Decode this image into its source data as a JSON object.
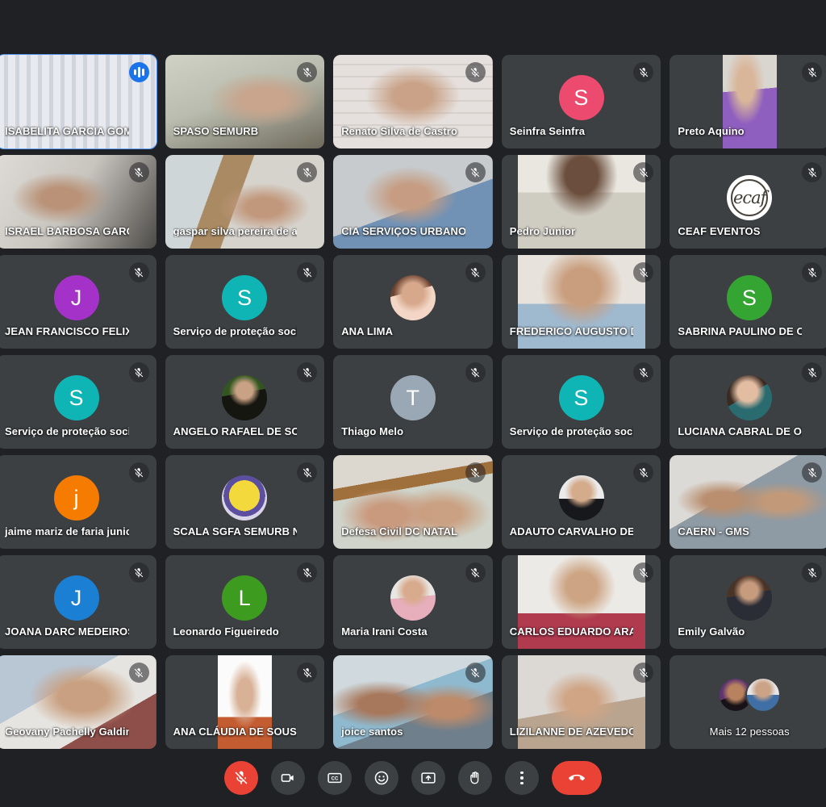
{
  "meeting": {
    "grid_columns": 5,
    "grid_rows": 7,
    "background_color": "#202124",
    "tile_color": "#3c4043",
    "active_speaker_border_color": "#5b9bf8"
  },
  "participants": [
    {
      "name": "ISABELITA GARCIA GOM...",
      "kind": "video",
      "muted": false,
      "speaking": true,
      "video_style": "vertical-blinds",
      "name_align": "left"
    },
    {
      "name": "SPASO SEMURB",
      "kind": "video",
      "muted": true,
      "speaking": false,
      "video_style": "man-frame-wall",
      "name_align": "left"
    },
    {
      "name": "Renato Silva de Castro",
      "kind": "video",
      "muted": true,
      "speaking": false,
      "video_style": "older-man-tile-wall",
      "name_align": "left"
    },
    {
      "name": "Seinfra Seinfra",
      "kind": "avatar",
      "initial": "S",
      "avatar_color": "#ec4a6e",
      "muted": true,
      "speaking": false,
      "name_align": "left"
    },
    {
      "name": "Preto Aquino",
      "kind": "video",
      "muted": true,
      "speaking": false,
      "video_style": "young-man-purple",
      "letterbox": "narrow",
      "name_align": "left"
    },
    {
      "name": "ISRAEL BARBOSA GARCIA",
      "kind": "video",
      "muted": true,
      "speaking": false,
      "video_style": "man-office-desk",
      "name_align": "left"
    },
    {
      "name": "gaspar silva pereira de a...",
      "kind": "video",
      "muted": true,
      "speaking": false,
      "video_style": "man-map-office",
      "name_align": "left"
    },
    {
      "name": "CIA SERVIÇOS URBANOS",
      "kind": "video",
      "muted": true,
      "speaking": false,
      "video_style": "man-blue-shirt-room",
      "name_align": "left"
    },
    {
      "name": "Pedro Junior",
      "kind": "video",
      "muted": true,
      "speaking": false,
      "video_style": "man-white-tshirt",
      "letterbox": "wide",
      "name_align": "left"
    },
    {
      "name": "CEAF EVENTOS",
      "kind": "logo",
      "logo_text": "ecaf",
      "muted": true,
      "speaking": false,
      "name_align": "left"
    },
    {
      "name": "JEAN FRANCISCO FELIX ...",
      "kind": "avatar",
      "initial": "J",
      "avatar_color": "#a532c8",
      "muted": true,
      "speaking": false,
      "name_align": "left"
    },
    {
      "name": "Serviço de proteção soci...",
      "kind": "avatar",
      "initial": "S",
      "avatar_color": "#0fb5b5",
      "muted": true,
      "speaking": false,
      "name_align": "left"
    },
    {
      "name": "ANA LIMA",
      "kind": "avatar-photo",
      "avatar_photo": "woman-curly-hair",
      "muted": true,
      "speaking": false,
      "name_align": "left"
    },
    {
      "name": "FREDERICO AUGUSTO D...",
      "kind": "video",
      "muted": true,
      "speaking": false,
      "video_style": "bald-man-blue-shirt",
      "letterbox": "wide",
      "name_align": "left"
    },
    {
      "name": "SABRINA PAULINO DE O...",
      "kind": "avatar",
      "initial": "S",
      "avatar_color": "#34a532",
      "muted": true,
      "speaking": false,
      "name_align": "left"
    },
    {
      "name": "Serviço de proteção soci...",
      "kind": "avatar",
      "initial": "S",
      "avatar_color": "#0fb5b5",
      "muted": true,
      "speaking": false,
      "name_align": "left"
    },
    {
      "name": "ANGELO RAFAEL DE SO...",
      "kind": "avatar-photo",
      "avatar_photo": "man-sunglasses-foliage",
      "muted": true,
      "speaking": false,
      "name_align": "left"
    },
    {
      "name": "Thiago Melo",
      "kind": "avatar",
      "initial": "T",
      "avatar_color": "#9aa8b5",
      "muted": true,
      "speaking": false,
      "name_align": "left"
    },
    {
      "name": "Serviço de proteção soci...",
      "kind": "avatar",
      "initial": "S",
      "avatar_color": "#0fb5b5",
      "muted": true,
      "speaking": false,
      "name_align": "left"
    },
    {
      "name": "LUCIANA CABRAL DE OL...",
      "kind": "avatar-photo",
      "avatar_photo": "woman-long-hair",
      "muted": true,
      "speaking": false,
      "name_align": "left"
    },
    {
      "name": "jaime mariz de faria junior",
      "kind": "avatar",
      "initial": "j",
      "avatar_color": "#f57c00",
      "muted": true,
      "speaking": false,
      "name_align": "left"
    },
    {
      "name": "SCALA SGFA SEMURB N...",
      "kind": "crest",
      "muted": true,
      "speaking": false,
      "name_align": "left"
    },
    {
      "name": "Defesa Civil DC NATAL",
      "kind": "video",
      "muted": true,
      "speaking": false,
      "video_style": "two-women-painting",
      "name_align": "left"
    },
    {
      "name": "ADAUTO CARVALHO DE ...",
      "kind": "avatar-photo",
      "avatar_photo": "man-beard-black-shirt",
      "muted": true,
      "speaking": false,
      "name_align": "left"
    },
    {
      "name": "CAERN - GMS",
      "kind": "video",
      "muted": true,
      "speaking": false,
      "video_style": "two-men-office",
      "name_align": "left"
    },
    {
      "name": "JOANA DARC MEDEIROS",
      "kind": "avatar",
      "initial": "J",
      "avatar_color": "#1b7fd4",
      "muted": true,
      "speaking": false,
      "name_align": "left"
    },
    {
      "name": "Leonardo Figueiredo",
      "kind": "avatar",
      "initial": "L",
      "avatar_color": "#3d9c20",
      "muted": true,
      "speaking": false,
      "name_align": "left"
    },
    {
      "name": "Maria Irani Costa",
      "kind": "avatar-photo",
      "avatar_photo": "woman-pink-top",
      "muted": true,
      "speaking": false,
      "name_align": "left"
    },
    {
      "name": "CARLOS EDUARDO ARA...",
      "kind": "video",
      "muted": true,
      "speaking": false,
      "video_style": "man-headphones-red",
      "letterbox": "wide",
      "name_align": "left"
    },
    {
      "name": "Emily Galvão",
      "kind": "avatar-photo",
      "avatar_photo": "woman-dark-jacket",
      "muted": true,
      "speaking": false,
      "name_align": "left"
    },
    {
      "name": "Geovany Pachelly Galdin...",
      "kind": "video",
      "muted": true,
      "speaking": false,
      "video_style": "man-glasses-door",
      "name_align": "left"
    },
    {
      "name": "ANA CLÁUDIA DE SOUS...",
      "kind": "video",
      "muted": true,
      "speaking": false,
      "video_style": "woman-white-bg",
      "letterbox": "narrow",
      "name_align": "left"
    },
    {
      "name": "joice santos",
      "kind": "video",
      "muted": true,
      "speaking": false,
      "video_style": "two-women-blue-wall",
      "name_align": "left"
    },
    {
      "name": "LIZILANNE DE AZEVEDO ...",
      "kind": "video",
      "muted": true,
      "speaking": false,
      "video_style": "woman-glasses-blur",
      "letterbox": "wide",
      "name_align": "left"
    },
    {
      "name": "Mais 12 pessoas",
      "kind": "overflow",
      "overflow_count": 12,
      "muted": false,
      "speaking": false,
      "name_align": "center"
    }
  ],
  "toolbar": {
    "controls": [
      {
        "id": "microphone",
        "icon": "mic-off-icon",
        "label": "Desativar microfone",
        "state": "muted",
        "style": "danger"
      },
      {
        "id": "camera",
        "icon": "video-camera-icon",
        "label": "Desativar câmera",
        "state": "off",
        "style": "neutral"
      },
      {
        "id": "captions",
        "icon": "closed-captions-icon",
        "label": "Ativar legendas",
        "state": "off",
        "style": "neutral"
      },
      {
        "id": "reactions",
        "icon": "emoji-smiley-icon",
        "label": "Enviar uma reação",
        "state": "off",
        "style": "neutral"
      },
      {
        "id": "present",
        "icon": "present-screen-icon",
        "label": "Apresentar agora",
        "state": "off",
        "style": "neutral"
      },
      {
        "id": "raise-hand",
        "icon": "raised-hand-icon",
        "label": "Levantar a mão",
        "state": "off",
        "style": "neutral"
      },
      {
        "id": "more-options",
        "icon": "more-vertical-icon",
        "label": "Mais opções",
        "state": "off",
        "style": "neutral"
      },
      {
        "id": "end-call",
        "icon": "phone-hangup-icon",
        "label": "Sair da chamada",
        "state": "off",
        "style": "hangup"
      }
    ]
  }
}
